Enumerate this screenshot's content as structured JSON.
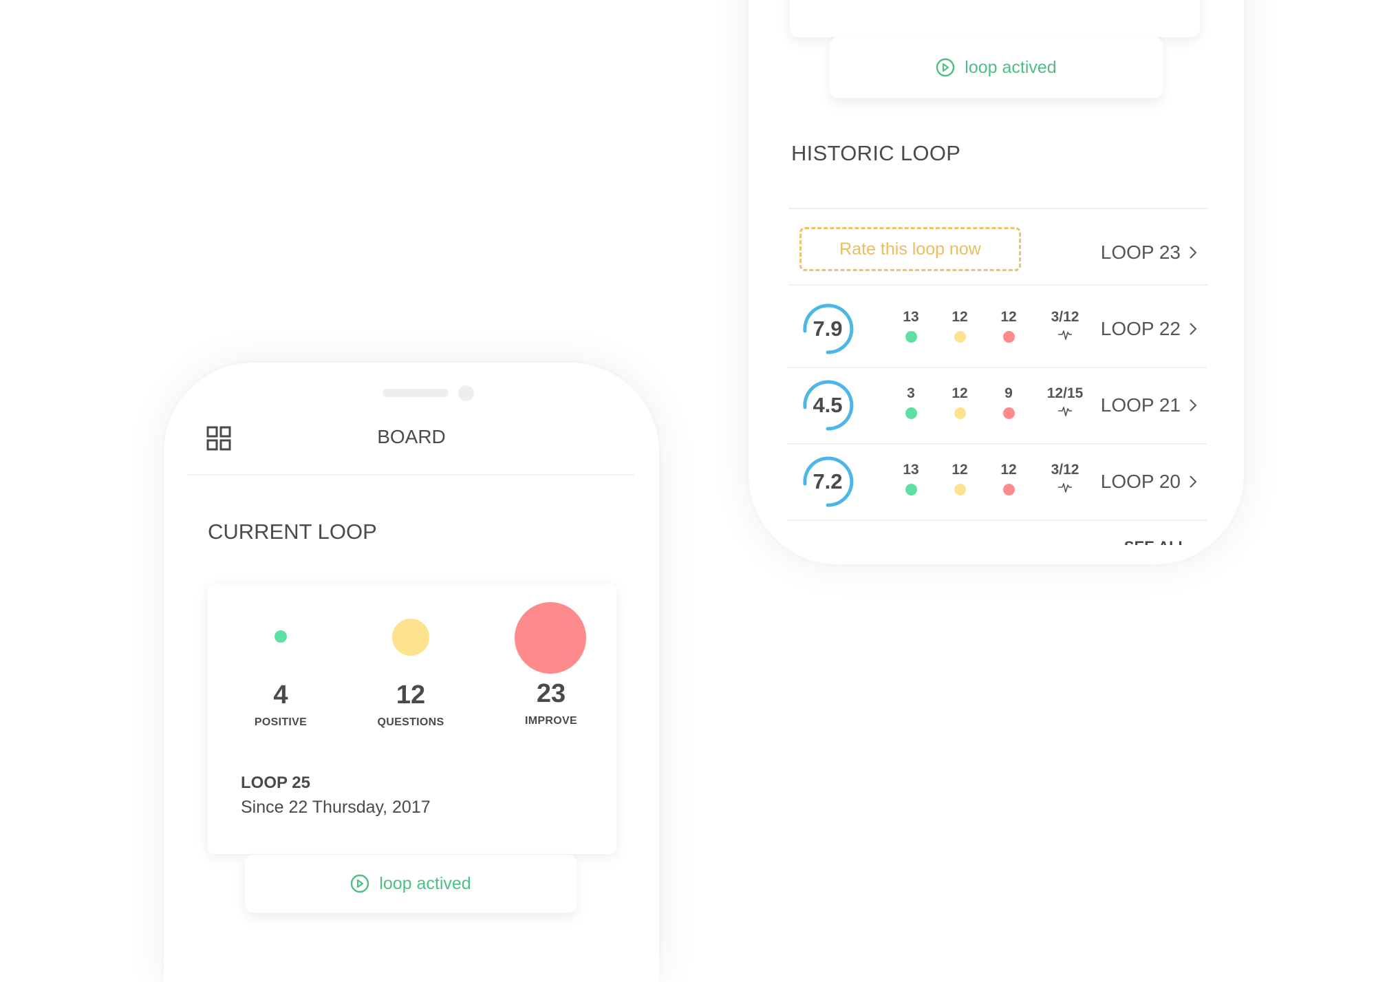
{
  "colors": {
    "positive": "#5ee0a0",
    "questions": "#fde28f",
    "improve": "#fd8b8b",
    "accent_green": "#4dbf84",
    "accent_yellow": "#ecbd5c",
    "ring_blue": "#4bb6e8",
    "text": "#4a4a4a"
  },
  "historic_screen": {
    "status": {
      "icon": "play-circle-icon",
      "label": "loop actived"
    },
    "section_title": "HISTORIC LOOP",
    "pending": {
      "button_label": "Rate this loop now",
      "loop_label": "LOOP 23"
    },
    "rows": [
      {
        "score": "7.9",
        "positive": "13",
        "questions": "12",
        "improve": "12",
        "actions": "3/12",
        "loop_label": "LOOP 22"
      },
      {
        "score": "4.5",
        "positive": "3",
        "questions": "12",
        "improve": "9",
        "actions": "12/15",
        "loop_label": "LOOP 21"
      },
      {
        "score": "7.2",
        "positive": "13",
        "questions": "12",
        "improve": "12",
        "actions": "3/12",
        "loop_label": "LOOP 20"
      }
    ],
    "see_all_label": "SEE ALL"
  },
  "board_screen": {
    "header": {
      "menu_icon": "grid-icon",
      "title": "BOARD"
    },
    "section_title": "CURRENT LOOP",
    "current_loop": {
      "stats": [
        {
          "key": "positive",
          "count": "4",
          "label": "POSITIVE"
        },
        {
          "key": "questions",
          "count": "12",
          "label": "QUESTIONS"
        },
        {
          "key": "improve",
          "count": "23",
          "label": "IMPROVE"
        }
      ],
      "name": "LOOP 25",
      "since": "Since 22 Thursday, 2017"
    },
    "status": {
      "icon": "play-circle-icon",
      "label": "loop actived"
    }
  }
}
